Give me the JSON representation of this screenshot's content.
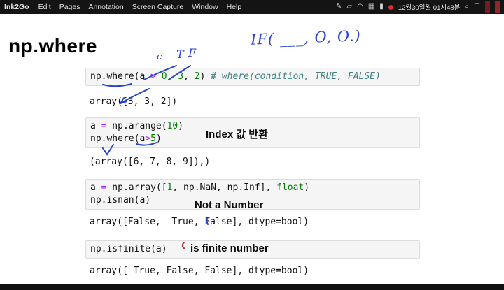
{
  "menubar": {
    "app_name": "Ink2Go",
    "menus": [
      "Edit",
      "Pages",
      "Annotation",
      "Screen Capture",
      "Window",
      "Help"
    ],
    "icons": {
      "pen": "✎",
      "shapes": "▱",
      "arc": "◠",
      "grid": "▦",
      "battery": "▮",
      "search": "⌕",
      "list": "☰"
    },
    "datetime": "12월30일월 01시48분"
  },
  "page": {
    "title": "np.where"
  },
  "handwritten": {
    "if_note": "IF( ___, O, O.)",
    "condition_label": "c",
    "true_label": "T",
    "false_label": "F"
  },
  "notes": {
    "index_return": "Index 값 반환",
    "not_a_number": "Not a Number",
    "is_finite": "is finite number"
  },
  "cells": [
    {
      "lines": [
        [
          {
            "t": "np.where(a "
          },
          {
            "t": ">",
            "c": "op"
          },
          {
            "t": " "
          },
          {
            "t": "0",
            "c": "num"
          },
          {
            "t": ", "
          },
          {
            "t": "3",
            "c": "num"
          },
          {
            "t": ", "
          },
          {
            "t": "2",
            "c": "num"
          },
          {
            "t": ") "
          },
          {
            "t": "# where(condition, TRUE, FALSE)",
            "c": "com"
          }
        ]
      ],
      "output": "array([3, 3, 2])"
    },
    {
      "lines": [
        [
          {
            "t": "a "
          },
          {
            "t": "=",
            "c": "op"
          },
          {
            "t": " np.arange("
          },
          {
            "t": "10",
            "c": "num"
          },
          {
            "t": ")"
          }
        ],
        [
          {
            "t": "np.where(a"
          },
          {
            "t": ">",
            "c": "op"
          },
          {
            "t": "5",
            "c": "num"
          },
          {
            "t": ")"
          }
        ]
      ],
      "output": "(array([6, 7, 8, 9]),)"
    },
    {
      "lines": [
        [
          {
            "t": "a "
          },
          {
            "t": "=",
            "c": "op"
          },
          {
            "t": " np.array(["
          },
          {
            "t": "1",
            "c": "num"
          },
          {
            "t": ", np.NaN, np.Inf], "
          },
          {
            "t": "float",
            "c": "kw"
          },
          {
            "t": ")"
          }
        ],
        [
          {
            "t": "np.isnan(a)"
          }
        ]
      ],
      "output": "array([False,  True, False], dtype=bool)"
    },
    {
      "lines": [
        [
          {
            "t": "np.isfinite(a)"
          }
        ]
      ],
      "output": "array([ True, False, False], dtype=bool)"
    }
  ]
}
